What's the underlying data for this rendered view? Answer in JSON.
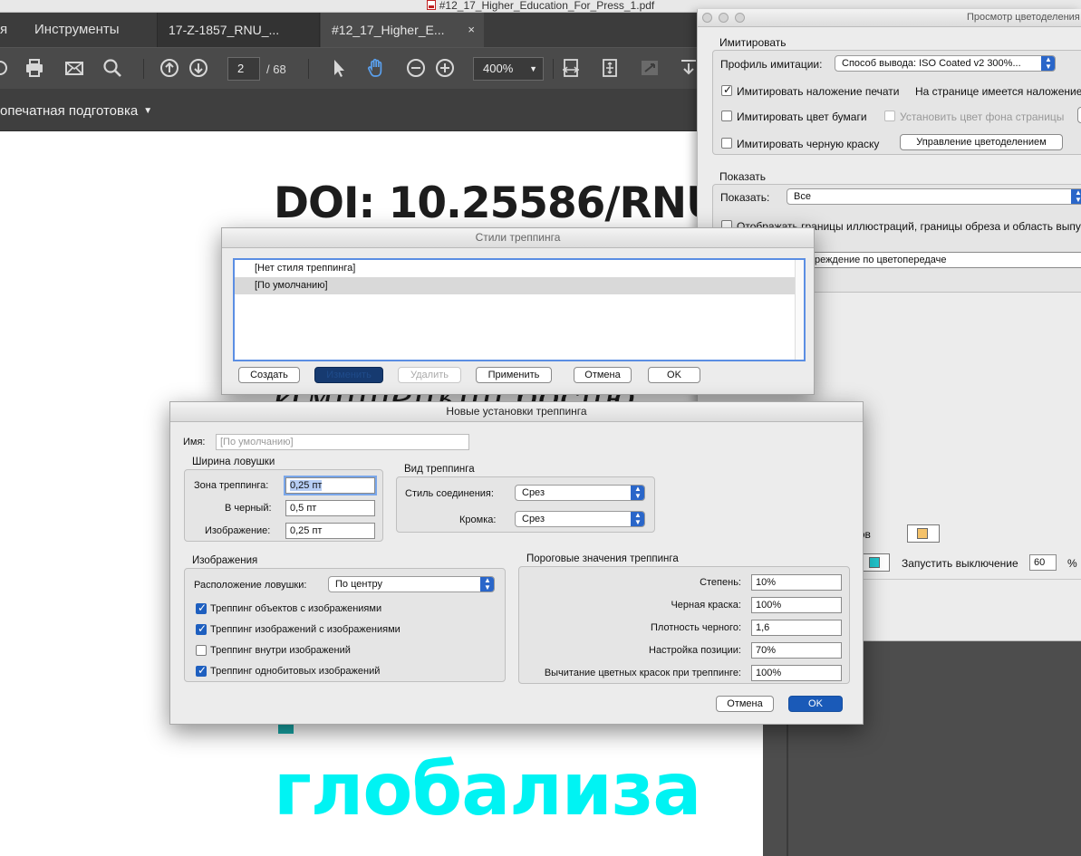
{
  "window_title": "#12_17_Higher_Education_For_Press_1.pdf",
  "tabs": {
    "menu_partial": "я",
    "tools": "Инструменты",
    "doc1": "17-Z-1857_RNU_...",
    "doc2": "#12_17_Higher_E...",
    "close": "×"
  },
  "toolbar": {
    "page": "2",
    "page_total": "/ 68",
    "zoom": "400%"
  },
  "subbar": {
    "label": "опечатная подготовка"
  },
  "document": {
    "doi": "DOI: 10.25586/RNU.",
    "italic": "Имишейкий босию",
    "big_word": "глобализа"
  },
  "separations": {
    "title": "Просмотр цветоделения",
    "simulate_group": "Имитировать",
    "profile_label": "Профиль имитации:",
    "profile_value": "Способ вывода: ISO Coated v2 300%...",
    "overprint_label": "Имитировать наложение печати",
    "overprint_note": "На странице имеется наложение:",
    "paper_color_label": "Имитировать цвет бумаги",
    "page_bg_label": "Установить цвет фона страницы",
    "black_ink_label": "Имитировать черную краску",
    "ink_manager_button": "Управление цветоделением",
    "show_group": "Показать",
    "show_label": "Показать:",
    "show_value": "Все",
    "art_trim_label": "Отображать границы иллюстраций, границы обреза и область выпус",
    "warning_partial": "преждение по цветопередаче",
    "colors_partial": "ветов",
    "start_off_label": "Запустить выключение",
    "start_off_value": "60",
    "percent": "%"
  },
  "trap_presets": {
    "title": "Стили треппинга",
    "items": [
      "[Нет стиля треппинга]",
      "[По умолчанию]"
    ],
    "buttons": {
      "create": "Создать",
      "edit": "Изменить",
      "delete": "Удалить",
      "apply": "Применить",
      "cancel": "Отмена",
      "ok": "OK"
    }
  },
  "new_trap": {
    "title": "Новые установки треппинга",
    "name_label": "Имя:",
    "name_placeholder": "[По умолчанию]",
    "trap_width": {
      "title": "Ширина ловушки",
      "zone_label": "Зона треппинга:",
      "zone_value": "0,25 пт",
      "black_label": "В черный:",
      "black_value": "0,5 пт",
      "image_label": "Изображение:",
      "image_value": "0,25 пт"
    },
    "trap_type": {
      "title": "Вид треппинга",
      "join_label": "Стиль соединения:",
      "join_value": "Срез",
      "end_label": "Кромка:",
      "end_value": "Срез"
    },
    "images": {
      "title": "Изображения",
      "placement_label": "Расположение ловушки:",
      "placement_value": "По центру",
      "opt1": "Треппинг объектов с изображениями",
      "opt2": "Треппинг изображений с изображениями",
      "opt3": "Треппинг внутри изображений",
      "opt4": "Треппинг однобитовых изображений"
    },
    "thresholds": {
      "title": "Пороговые значения треппинга",
      "step_label": "Степень:",
      "step_value": "10%",
      "black_ink_label": "Черная краска:",
      "black_ink_value": "100%",
      "black_density_label": "Плотность черного:",
      "black_density_value": "1,6",
      "sliding_label": "Настройка позиции:",
      "sliding_value": "70%",
      "reduction_label": "Вычитание цветных красок при треппинге:",
      "reduction_value": "100%"
    },
    "buttons": {
      "cancel": "Отмена",
      "ok": "OK"
    }
  }
}
